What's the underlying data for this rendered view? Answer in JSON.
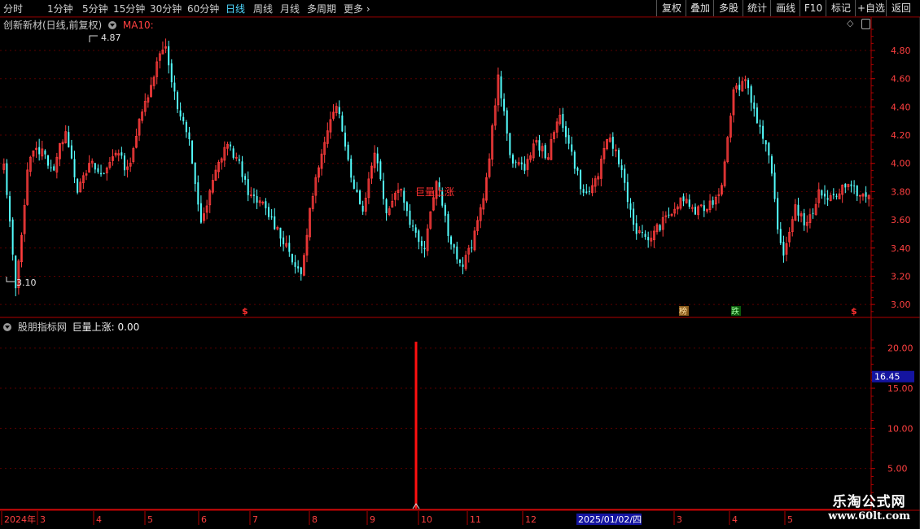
{
  "toolbar": {
    "periods": [
      "分时",
      "1分钟",
      "5分钟",
      "15分钟",
      "30分钟",
      "60分钟",
      "日线",
      "周线",
      "月线",
      "多周期",
      "更多"
    ],
    "active_period": "日线",
    "buttons": [
      "复权",
      "叠加",
      "多股",
      "统计",
      "画线",
      "F10",
      "标记",
      "+自选",
      "返回"
    ]
  },
  "main_chart": {
    "title": "创新新材(日线,前复权)",
    "indicator": "MA10:",
    "high_label": "4.87",
    "low_label": "3.10",
    "signal_label": "巨量上涨",
    "markers": [
      "$",
      "榜",
      "跌",
      "$"
    ]
  },
  "sub_chart": {
    "title": "股朋指标网",
    "value_text": "巨量上涨: 0.00",
    "current_value": "16.45"
  },
  "time_axis": {
    "labels": [
      "2024年",
      "3",
      "4",
      "5",
      "6",
      "7",
      "8",
      "9",
      "10",
      "11",
      "12",
      "2025/01/02/四",
      "3",
      "4",
      "5"
    ]
  },
  "watermark": {
    "line1": "乐淘公式网",
    "line2": "www.60lt.com"
  },
  "colors": {
    "up": "#ff3c3c",
    "down": "#54ffff",
    "axis": "#b00000",
    "grid": "#5a0000",
    "signal_bar": "#ff1010",
    "active": "#4fd8ff"
  },
  "chart_data": [
    {
      "type": "candlestick",
      "ylim": [
        2.92,
        4.95
      ],
      "yticks": [
        "4.80",
        "4.60",
        "4.40",
        "4.20",
        "4.00",
        "3.80",
        "3.60",
        "3.40",
        "3.20",
        "3.00"
      ],
      "ohlc_anchors": [
        {
          "close": 3.98
        },
        {
          "close": 3.1
        },
        {
          "close": 4.05
        },
        {
          "close": 4.1
        },
        {
          "close": 3.95
        },
        {
          "close": 4.25
        },
        {
          "close": 3.8
        },
        {
          "close": 4.0
        },
        {
          "close": 3.9
        },
        {
          "close": 4.1
        },
        {
          "close": 3.95
        },
        {
          "close": 4.3
        },
        {
          "close": 4.6
        },
        {
          "close": 4.87
        },
        {
          "close": 4.4
        },
        {
          "close": 4.15
        },
        {
          "close": 3.55
        },
        {
          "close": 3.9
        },
        {
          "close": 4.15
        },
        {
          "close": 4.0
        },
        {
          "close": 3.75
        },
        {
          "close": 3.7
        },
        {
          "close": 3.55
        },
        {
          "close": 3.4
        },
        {
          "close": 3.18
        },
        {
          "close": 3.8
        },
        {
          "close": 4.15
        },
        {
          "close": 4.45
        },
        {
          "close": 3.95
        },
        {
          "close": 3.65
        },
        {
          "close": 4.1
        },
        {
          "close": 3.65
        },
        {
          "close": 3.85
        },
        {
          "close": 3.55
        },
        {
          "close": 3.4
        },
        {
          "close": 3.9
        },
        {
          "close": 3.5
        },
        {
          "close": 3.25
        },
        {
          "close": 3.45
        },
        {
          "close": 3.85
        },
        {
          "close": 4.6
        },
        {
          "close": 4.05
        },
        {
          "close": 3.95
        },
        {
          "close": 4.15
        },
        {
          "close": 4.05
        },
        {
          "close": 4.35
        },
        {
          "close": 4.05
        },
        {
          "close": 3.75
        },
        {
          "close": 3.9
        },
        {
          "close": 4.2
        },
        {
          "close": 3.95
        },
        {
          "close": 3.55
        },
        {
          "close": 3.45
        },
        {
          "close": 3.55
        },
        {
          "close": 3.65
        },
        {
          "close": 3.75
        },
        {
          "close": 3.65
        },
        {
          "close": 3.7
        },
        {
          "close": 3.8
        },
        {
          "close": 4.5
        },
        {
          "close": 4.6
        },
        {
          "close": 4.3
        },
        {
          "close": 4.0
        },
        {
          "close": 3.3
        },
        {
          "close": 3.7
        },
        {
          "close": 3.55
        },
        {
          "close": 3.8
        },
        {
          "close": 3.75
        },
        {
          "close": 3.85
        },
        {
          "close": 3.8
        },
        {
          "close": 3.75
        }
      ]
    },
    {
      "type": "bar",
      "series_name": "巨量上涨",
      "ylim": [
        0,
        22
      ],
      "yticks": [
        "20.00",
        "15.00",
        "10.00",
        "5.00"
      ],
      "spike": {
        "x_label": "10",
        "value": 20.8
      },
      "current": 16.45
    }
  ]
}
